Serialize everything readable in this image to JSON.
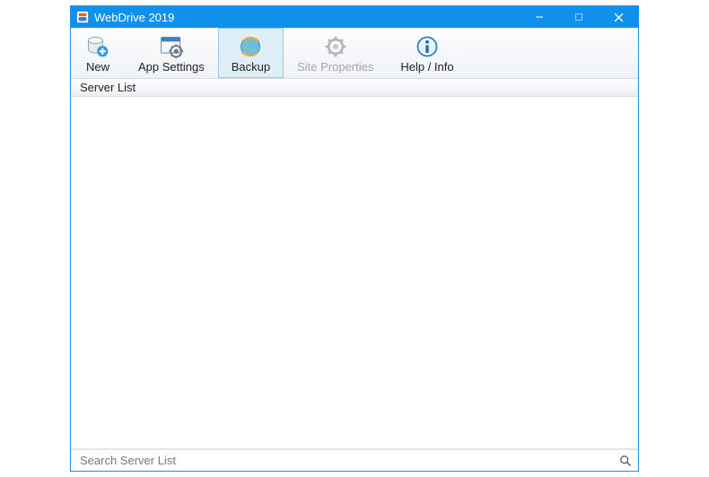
{
  "window": {
    "title": "WebDrive 2019"
  },
  "toolbar": {
    "new": "New",
    "app_settings": "App Settings",
    "backup": "Backup",
    "site_properties": "Site Properties",
    "help_info": "Help / Info"
  },
  "panels": {
    "server_list_header": "Server List"
  },
  "search": {
    "placeholder": "Search Server List"
  }
}
